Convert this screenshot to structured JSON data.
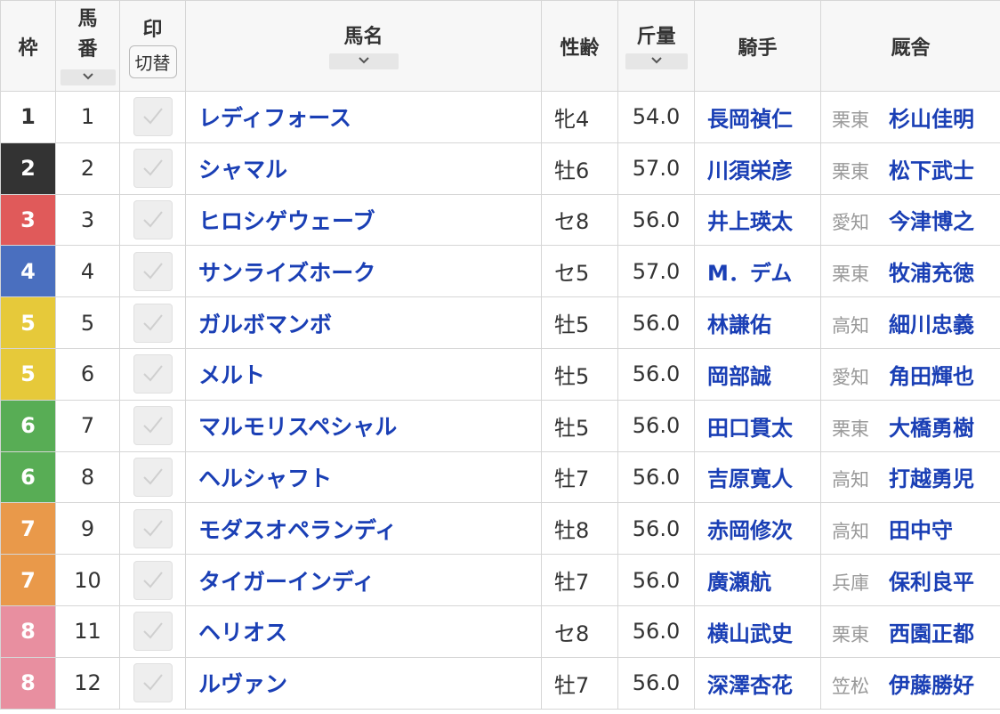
{
  "header": {
    "waku": "枠",
    "umaban_line1": "馬",
    "umaban_line2": "番",
    "mark": "印",
    "swap": "切替",
    "name": "馬名",
    "sex_age": "性齢",
    "kinryo": "斤量",
    "jockey": "騎手",
    "stable": "厩舎"
  },
  "colors": {
    "waku1": "#ffffff",
    "waku2": "#333333",
    "waku3": "#e05a5a",
    "waku4": "#4a6fbf",
    "waku5": "#e6c93a",
    "waku6": "#58ad55",
    "waku7": "#e9994a",
    "waku8": "#e88fa0",
    "link": "#1a3fb5"
  },
  "rows": [
    {
      "waku": "1",
      "num": "1",
      "name": "レディフォース",
      "sex_age": "牝4",
      "kinryo": "54.0",
      "jockey": "長岡禎仁",
      "loc": "栗東",
      "trainer": "杉山佳明"
    },
    {
      "waku": "2",
      "num": "2",
      "name": "シャマル",
      "sex_age": "牡6",
      "kinryo": "57.0",
      "jockey": "川須栄彦",
      "loc": "栗東",
      "trainer": "松下武士"
    },
    {
      "waku": "3",
      "num": "3",
      "name": "ヒロシゲウェーブ",
      "sex_age": "セ8",
      "kinryo": "56.0",
      "jockey": "井上瑛太",
      "loc": "愛知",
      "trainer": "今津博之"
    },
    {
      "waku": "4",
      "num": "4",
      "name": "サンライズホーク",
      "sex_age": "セ5",
      "kinryo": "57.0",
      "jockey": "M．デム",
      "loc": "栗東",
      "trainer": "牧浦充徳"
    },
    {
      "waku": "5",
      "num": "5",
      "name": "ガルボマンボ",
      "sex_age": "牡5",
      "kinryo": "56.0",
      "jockey": "林謙佑",
      "loc": "高知",
      "trainer": "細川忠義"
    },
    {
      "waku": "5",
      "num": "6",
      "name": "メルト",
      "sex_age": "牡5",
      "kinryo": "56.0",
      "jockey": "岡部誠",
      "loc": "愛知",
      "trainer": "角田輝也"
    },
    {
      "waku": "6",
      "num": "7",
      "name": "マルモリスペシャル",
      "sex_age": "牡5",
      "kinryo": "56.0",
      "jockey": "田口貫太",
      "loc": "栗東",
      "trainer": "大橋勇樹"
    },
    {
      "waku": "6",
      "num": "8",
      "name": "ヘルシャフト",
      "sex_age": "牡7",
      "kinryo": "56.0",
      "jockey": "吉原寛人",
      "loc": "高知",
      "trainer": "打越勇児"
    },
    {
      "waku": "7",
      "num": "9",
      "name": "モダスオペランディ",
      "sex_age": "牡8",
      "kinryo": "56.0",
      "jockey": "赤岡修次",
      "loc": "高知",
      "trainer": "田中守"
    },
    {
      "waku": "7",
      "num": "10",
      "name": "タイガーインディ",
      "sex_age": "牡7",
      "kinryo": "56.0",
      "jockey": "廣瀬航",
      "loc": "兵庫",
      "trainer": "保利良平"
    },
    {
      "waku": "8",
      "num": "11",
      "name": "ヘリオス",
      "sex_age": "セ8",
      "kinryo": "56.0",
      "jockey": "横山武史",
      "loc": "栗東",
      "trainer": "西園正都"
    },
    {
      "waku": "8",
      "num": "12",
      "name": "ルヴァン",
      "sex_age": "牡7",
      "kinryo": "56.0",
      "jockey": "深澤杏花",
      "loc": "笠松",
      "trainer": "伊藤勝好"
    }
  ]
}
